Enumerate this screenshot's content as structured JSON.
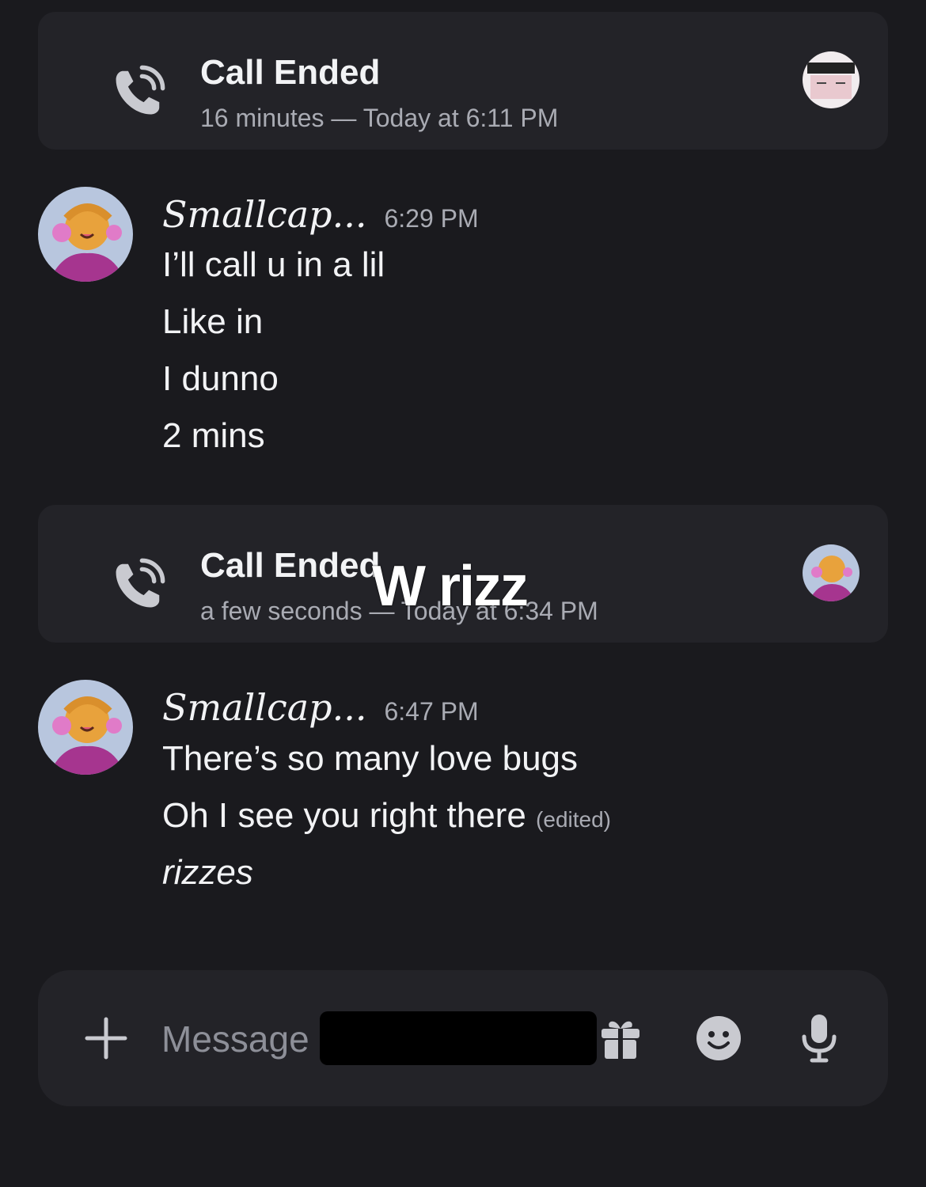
{
  "calls": [
    {
      "title": "Call Ended",
      "subtitle": "16 minutes — Today at 6:11 PM"
    },
    {
      "title": "Call Ended",
      "subtitle": "a few seconds — Today at 6:34 PM"
    }
  ],
  "message_groups": [
    {
      "username": "Smallcap...",
      "time": "6:29 PM",
      "lines": [
        "I’ll call u in a lil",
        "Like in",
        "I dunno",
        "2 mins"
      ]
    },
    {
      "username": "Smallcap...",
      "time": "6:47 PM",
      "lines": [
        "There’s so many love bugs",
        "Oh I see you right there",
        "rizzes"
      ],
      "edited_label": "(edited)"
    }
  ],
  "overlay": "W rizz",
  "composer": {
    "placeholder": "Message @"
  },
  "colors": {
    "background": "#1a1a1e",
    "card": "#232328",
    "muted": "#a9abb3"
  }
}
